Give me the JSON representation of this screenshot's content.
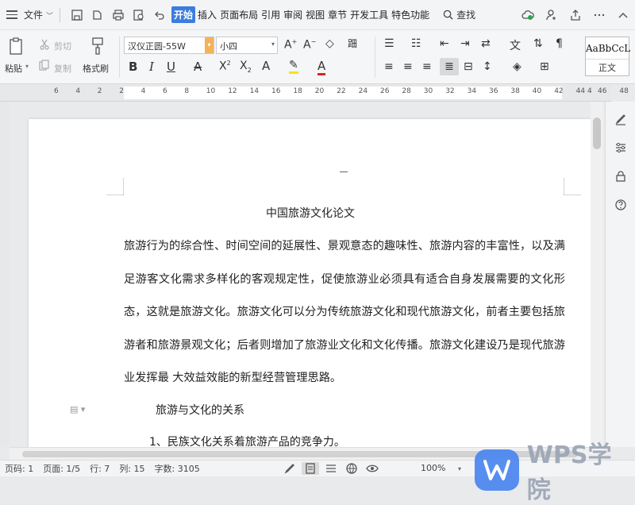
{
  "menubar": {
    "file_label": "文件",
    "tabs": [
      "开始",
      "插入",
      "页面布局",
      "引用",
      "审阅",
      "视图",
      "章节",
      "开发工具",
      "特色功能"
    ],
    "active_tab": "开始",
    "search_label": "查找"
  },
  "ribbon": {
    "paste_label": "粘贴",
    "cut_label": "剪切",
    "copy_label": "复制",
    "format_painter_label": "格式刷",
    "font_name": "汉仪正圆-55W",
    "font_size": "小四",
    "style_preview": "AaBbCcL",
    "style_name": "正文"
  },
  "ruler": {
    "numbers": [
      "6",
      "4",
      "2",
      "2",
      "4",
      "6",
      "8",
      "10",
      "12",
      "14",
      "16",
      "18",
      "20",
      "22",
      "24",
      "26",
      "28",
      "30",
      "32",
      "34",
      "36",
      "38",
      "40",
      "42",
      "44",
      "46",
      "48",
      "4"
    ]
  },
  "document": {
    "title": "中国旅游文化论文",
    "paragraph": "旅游行为的综合性、时间空间的延展性、景观意态的趣味性、旅游内容的丰富性，以及满足游客文化需求多样化的客观规定性，促使旅游业必须具有适合自身发展需要的文化形态，这就是旅游文化。旅游文化可以分为传统旅游文化和现代旅游文化，前者主要包括旅游者和旅游景观文化；后者则增加了旅游业文化和文化传播。旅游文化建设乃是现代旅游业发挥最 大效益效能的新型经营管理思路。",
    "heading2": "旅游与文化的关系",
    "heading3": "1、民族文化关系着旅游产品的竞争力。"
  },
  "status": {
    "page_code": "页码: 1",
    "page": "页面: 1/5",
    "row": "行: 7",
    "col": "列: 15",
    "word_count": "字数: 3105",
    "zoom": "100%"
  },
  "watermark": {
    "brand": "WPS学院"
  },
  "colors": {
    "accent": "#3b7ddd",
    "wps_blue": "#4a86f0"
  }
}
